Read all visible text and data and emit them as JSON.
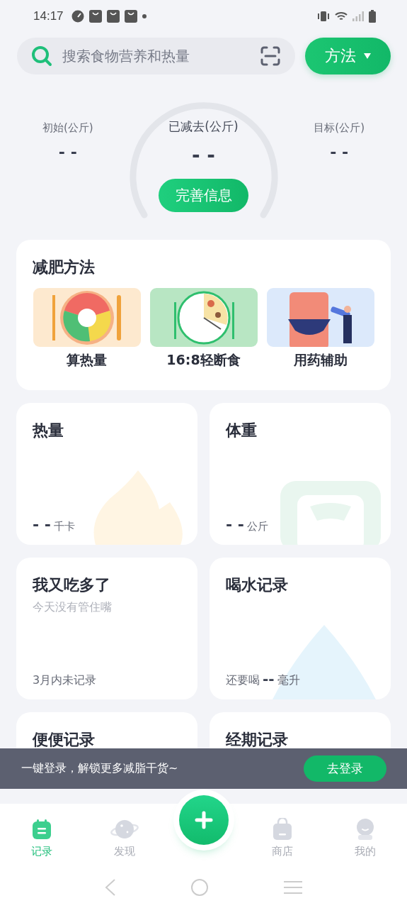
{
  "status_bar": {
    "time": "14:17"
  },
  "search": {
    "placeholder": "搜索食物营养和热量"
  },
  "method_button": {
    "label": "方法"
  },
  "stats": [
    {
      "kind": "side",
      "label": "初始(公斤)",
      "value": "- -"
    },
    {
      "kind": "main",
      "label": "已减去(公斤)",
      "value": "- -"
    },
    {
      "kind": "side",
      "label": "目标(公斤)",
      "value": "- -"
    }
  ],
  "complete_button": {
    "label": "完善信息"
  },
  "methods": {
    "title": "减肥方法",
    "items": [
      {
        "kind": "picture",
        "label": "算热量"
      },
      {
        "kind": "picture",
        "label": "16:8轻断食"
      },
      {
        "kind": "picture",
        "label": "用药辅助"
      }
    ]
  },
  "cards": [
    {
      "kind": "calorie",
      "title": "热量",
      "value": "- -",
      "unit": "千卡"
    },
    {
      "kind": "weight",
      "title": "体重",
      "value": "- -",
      "unit": "公斤"
    },
    {
      "kind": "overeat",
      "title": "我又吃多了",
      "subtitle": "今天没有管住嘴",
      "footer": "3月内未记录"
    },
    {
      "kind": "water",
      "title": "喝水记录",
      "prefix": "还要喝",
      "value": "--",
      "unit": "毫升"
    },
    {
      "kind": "plain",
      "title": "便便记录"
    },
    {
      "kind": "plain",
      "title": "经期记录"
    }
  ],
  "banner": {
    "text": "一键登录，解锁更多减脂干货~",
    "button": "去登录"
  },
  "tabs": [
    {
      "label": "记录",
      "selected": true
    },
    {
      "label": "发现",
      "selected": false
    },
    {
      "label": "商店",
      "selected": false
    },
    {
      "label": "我的",
      "selected": false
    }
  ]
}
